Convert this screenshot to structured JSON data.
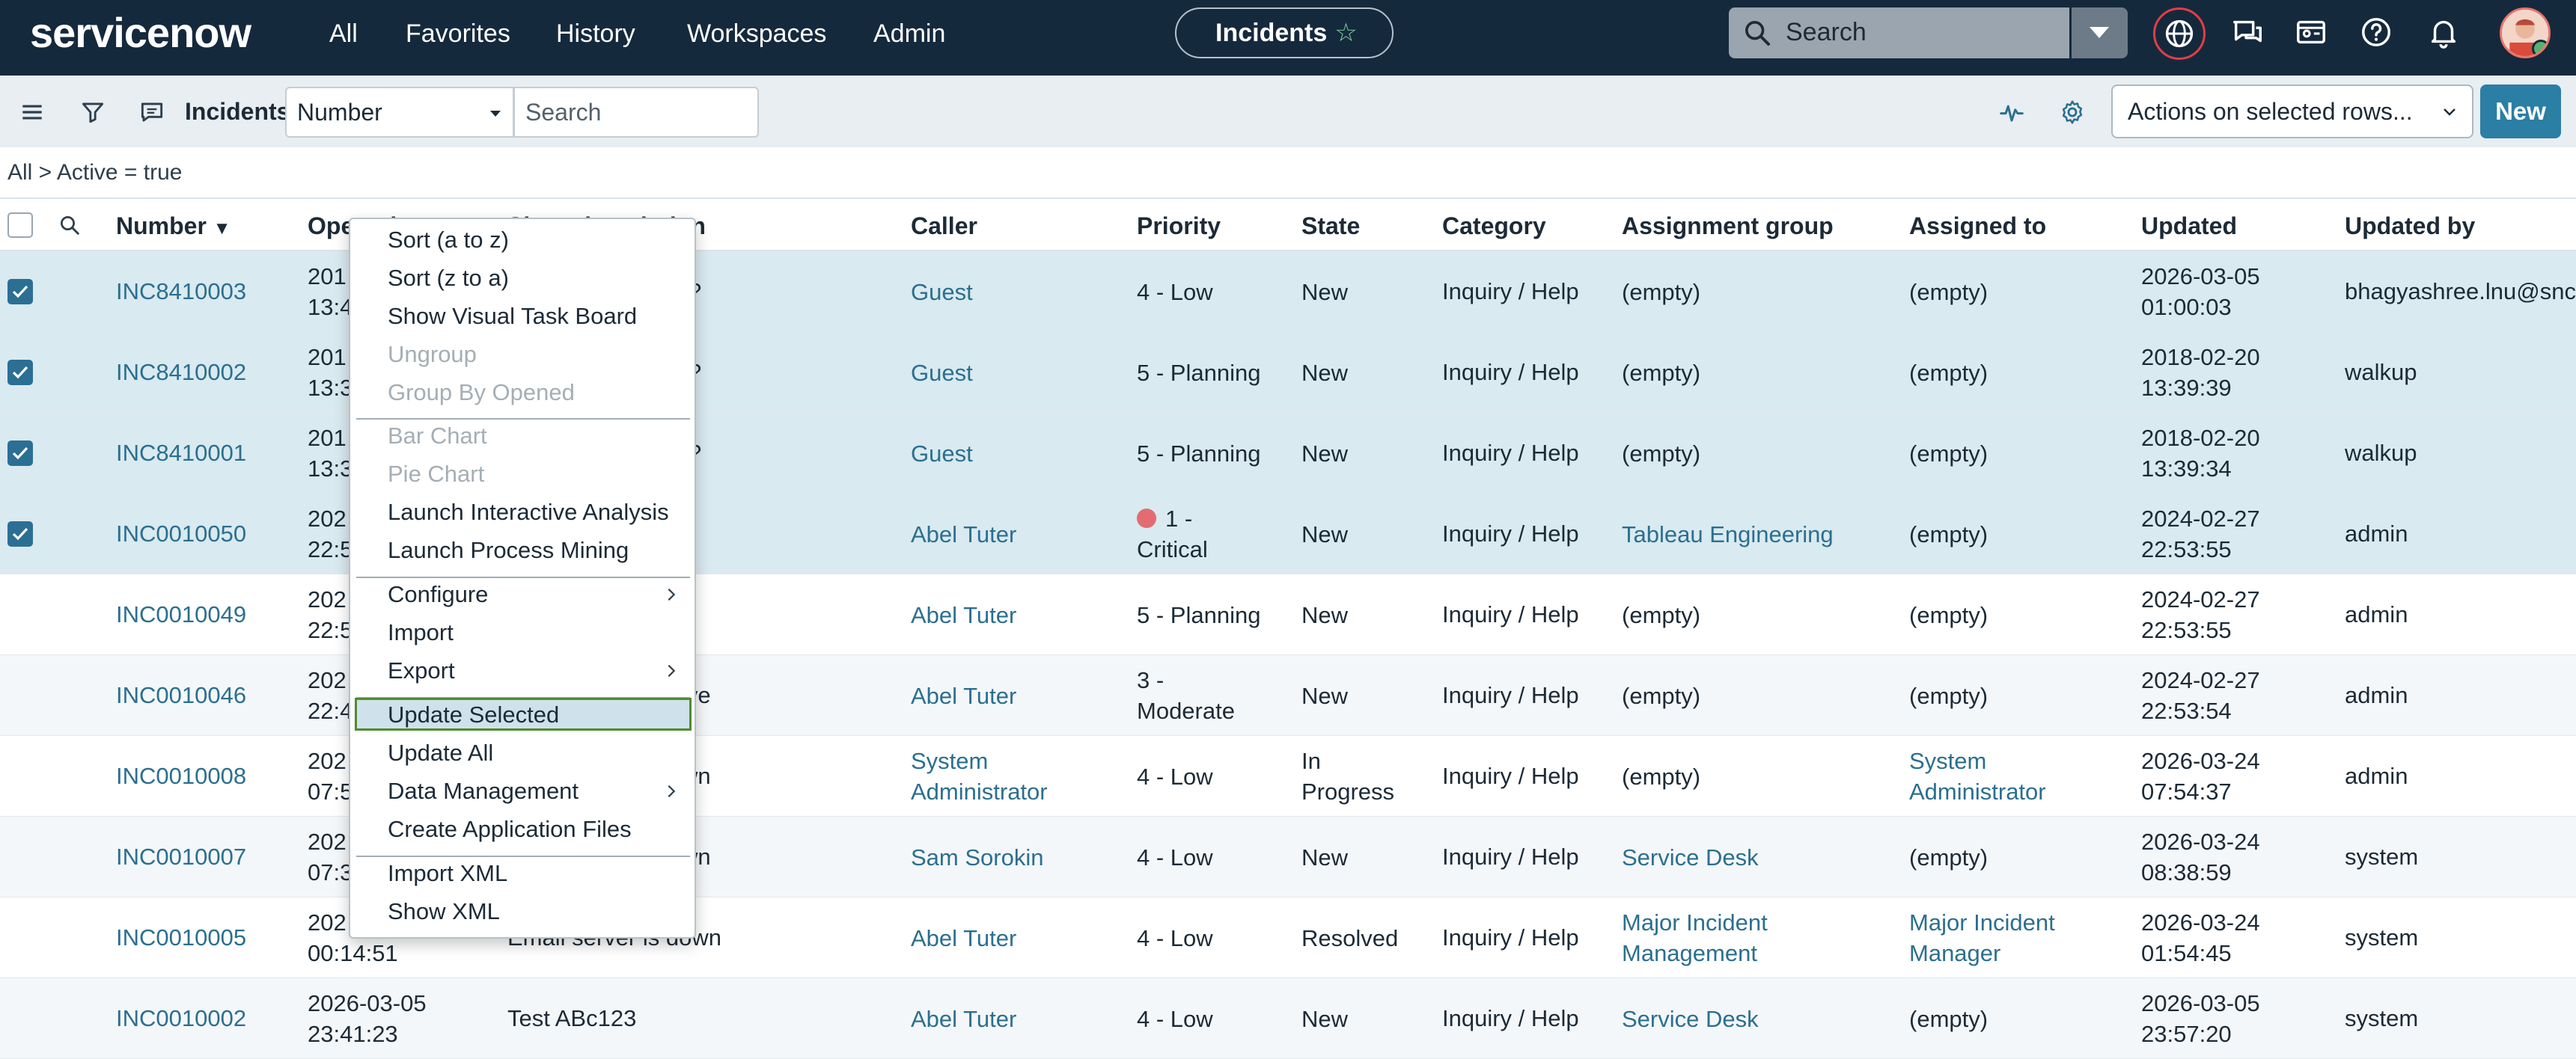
{
  "nav": {
    "brand": "servicenow",
    "menus": [
      "All",
      "Favorites",
      "History",
      "Workspaces",
      "Admin"
    ],
    "context_pill": "Incidents",
    "search_placeholder": "Search"
  },
  "listbar": {
    "title": "Incidents",
    "field_select": "Number",
    "search_placeholder": "Search",
    "actions_select": "Actions on selected rows...",
    "new_button": "New"
  },
  "breadcrumb": "All > Active = true",
  "columns": [
    "Number",
    "Opened",
    "Short description",
    "Caller",
    "Priority",
    "State",
    "Category",
    "Assignment group",
    "Assigned to",
    "Updated",
    "Updated by"
  ],
  "rows": [
    {
      "selected": true,
      "number": "INC8410003",
      "opened": [
        "201",
        "13:4"
      ],
      "desc": "?",
      "caller": [
        "Guest"
      ],
      "priority": [
        "4 - Low"
      ],
      "state": [
        "New"
      ],
      "category": "Inquiry / Help",
      "group": [
        "(empty)"
      ],
      "assigned": [
        "(empty)"
      ],
      "updated": [
        "2026-03-05",
        "01:00:03"
      ],
      "updated_by": "bhagyashree.lnu@snc"
    },
    {
      "selected": true,
      "number": "INC8410002",
      "opened": [
        "201",
        "13:3"
      ],
      "desc": "?",
      "caller": [
        "Guest"
      ],
      "priority": [
        "5 - Planning"
      ],
      "state": [
        "New"
      ],
      "category": "Inquiry / Help",
      "group": [
        "(empty)"
      ],
      "assigned": [
        "(empty)"
      ],
      "updated": [
        "2018-02-20",
        "13:39:39"
      ],
      "updated_by": "walkup"
    },
    {
      "selected": true,
      "number": "INC8410001",
      "opened": [
        "201",
        "13:3"
      ],
      "desc": "?",
      "caller": [
        "Guest"
      ],
      "priority": [
        "5 - Planning"
      ],
      "state": [
        "New"
      ],
      "category": "Inquiry / Help",
      "group": [
        "(empty)"
      ],
      "assigned": [
        "(empty)"
      ],
      "updated": [
        "2018-02-20",
        "13:39:34"
      ],
      "updated_by": "walkup"
    },
    {
      "selected": true,
      "number": "INC0010050",
      "opened": [
        "202",
        "22:5"
      ],
      "desc": "",
      "caller": [
        "Abel Tuter"
      ],
      "priority": [
        "1 -",
        "Critical"
      ],
      "critical": true,
      "state": [
        "New"
      ],
      "category": "Inquiry / Help",
      "group": [
        "Tableau Engineering"
      ],
      "group_link": true,
      "assigned": [
        "(empty)"
      ],
      "updated": [
        "2024-02-27",
        "22:53:55"
      ],
      "updated_by": "admin"
    },
    {
      "selected": false,
      "number": "INC0010049",
      "opened": [
        "202",
        "22:5"
      ],
      "desc": "",
      "caller": [
        "Abel Tuter"
      ],
      "priority": [
        "5 - Planning"
      ],
      "state": [
        "New"
      ],
      "category": "Inquiry / Help",
      "group": [
        "(empty)"
      ],
      "assigned": [
        "(empty)"
      ],
      "updated": [
        "2024-02-27",
        "22:53:55"
      ],
      "updated_by": "admin"
    },
    {
      "selected": false,
      "number": "INC0010046",
      "opened": [
        "202",
        "22:4"
      ],
      "desc": "ive",
      "caller": [
        "Abel Tuter"
      ],
      "priority": [
        "3 -",
        "Moderate"
      ],
      "state": [
        "New"
      ],
      "category": "Inquiry / Help",
      "group": [
        "(empty)"
      ],
      "assigned": [
        "(empty)"
      ],
      "updated": [
        "2024-02-27",
        "22:53:54"
      ],
      "updated_by": "admin"
    },
    {
      "selected": false,
      "number": "INC0010008",
      "opened": [
        "202",
        "07:5"
      ],
      "desc": "wn",
      "caller": [
        "System",
        "Administrator"
      ],
      "priority": [
        "4 - Low"
      ],
      "state": [
        "In",
        "Progress"
      ],
      "category": "Inquiry / Help",
      "group": [
        "(empty)"
      ],
      "assigned": [
        "System",
        "Administrator"
      ],
      "assigned_link": true,
      "updated": [
        "2026-03-24",
        "07:54:37"
      ],
      "updated_by": "admin"
    },
    {
      "selected": false,
      "number": "INC0010007",
      "opened": [
        "202",
        "07:3"
      ],
      "desc": "wn",
      "caller": [
        "Sam Sorokin"
      ],
      "priority": [
        "4 - Low"
      ],
      "state": [
        "New"
      ],
      "category": "Inquiry / Help",
      "group": [
        "Service Desk"
      ],
      "group_link": true,
      "assigned": [
        "(empty)"
      ],
      "updated": [
        "2026-03-24",
        "08:38:59"
      ],
      "updated_by": "system"
    },
    {
      "selected": false,
      "number": "INC0010005",
      "opened": [
        "202",
        "00:14:51"
      ],
      "desc": "Email server is down",
      "caller": [
        "Abel Tuter"
      ],
      "priority": [
        "4 - Low"
      ],
      "state": [
        "Resolved"
      ],
      "category": "Inquiry / Help",
      "group": [
        "Major Incident",
        "Management"
      ],
      "group_link": true,
      "assigned": [
        "Major Incident",
        "Manager"
      ],
      "assigned_link": true,
      "updated": [
        "2026-03-24",
        "01:54:45"
      ],
      "updated_by": "system"
    },
    {
      "selected": false,
      "number": "INC0010002",
      "opened": [
        "2026-03-05",
        "23:41:23"
      ],
      "desc": "Test ABc123",
      "caller": [
        "Abel Tuter"
      ],
      "priority": [
        "4 - Low"
      ],
      "state": [
        "New"
      ],
      "category": "Inquiry / Help",
      "group": [
        "Service Desk"
      ],
      "group_link": true,
      "assigned": [
        "(empty)"
      ],
      "updated": [
        "2026-03-05",
        "23:57:20"
      ],
      "updated_by": "system"
    }
  ],
  "context_menu": {
    "items": [
      {
        "label": "Sort (a to z)",
        "enabled": true
      },
      {
        "label": "Sort (z to a)",
        "enabled": true
      },
      {
        "label": "Show Visual Task Board",
        "enabled": true
      },
      {
        "label": "Ungroup",
        "enabled": false
      },
      {
        "label": "Group By Opened",
        "enabled": false
      },
      {
        "label": "Bar Chart",
        "enabled": false
      },
      {
        "label": "Pie Chart",
        "enabled": false
      },
      {
        "label": "Launch Interactive Analysis",
        "enabled": true
      },
      {
        "label": "Launch Process Mining",
        "enabled": true
      },
      {
        "label": "Configure",
        "enabled": true,
        "submenu": true
      },
      {
        "label": "Import",
        "enabled": true
      },
      {
        "label": "Export",
        "enabled": true,
        "submenu": true
      },
      {
        "label": "Update Selected",
        "enabled": true,
        "highlighted": true
      },
      {
        "label": "Update All",
        "enabled": true
      },
      {
        "label": "Data Management",
        "enabled": true,
        "submenu": true
      },
      {
        "label": "Create Application Files",
        "enabled": true
      },
      {
        "label": "Import XML",
        "enabled": true
      },
      {
        "label": "Show XML",
        "enabled": true
      }
    ]
  },
  "colors": {
    "nav_bg": "#15293d",
    "link": "#2b6f8f",
    "selected_row": "#d9eaf0",
    "primary_button": "#2b7ea4",
    "critical": "#e26c72",
    "focus_outline": "#4f8c2e"
  },
  "icons": [
    "search-icon",
    "star-icon",
    "globe-icon",
    "chat-icon",
    "contacts-icon",
    "help-icon",
    "bell-icon",
    "hamburger-icon",
    "filter-icon",
    "comment-icon",
    "pulse-icon",
    "gear-icon",
    "chevron-down-icon",
    "checkmark-icon",
    "chevron-right-icon"
  ]
}
